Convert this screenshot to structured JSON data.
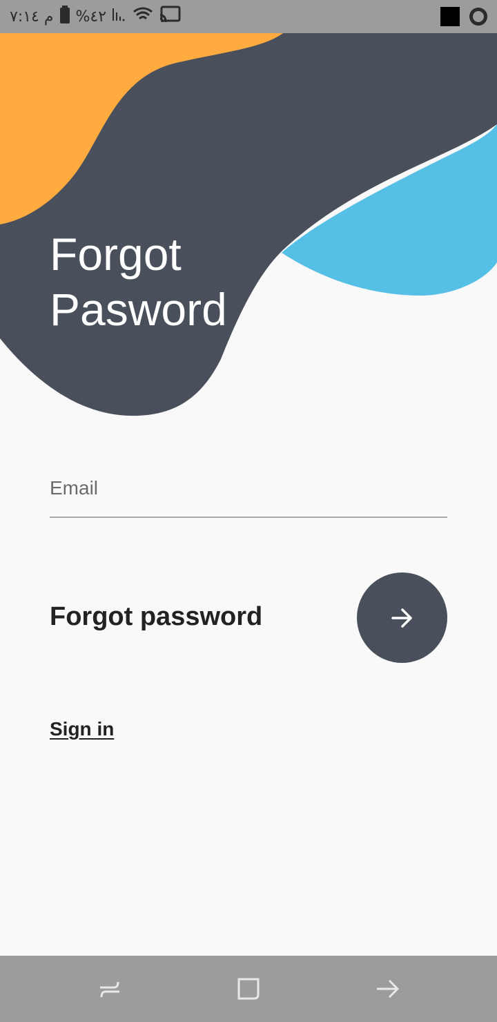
{
  "status_bar": {
    "time": "م ٧:١٤",
    "battery": "%٤٢",
    "icons": [
      "battery-icon",
      "signal-icon",
      "wifi-icon",
      "cast-icon",
      "square-notification-icon",
      "opera-icon"
    ]
  },
  "header": {
    "title_line1": "Forgot",
    "title_line2": "Pasword"
  },
  "form": {
    "email_placeholder": "Email",
    "email_value": "",
    "action_label": "Forgot password",
    "submit_icon": "arrow-right-icon",
    "sign_in_link": "Sign in"
  },
  "nav_bar": {
    "icons": [
      "recent-apps-icon",
      "home-icon",
      "back-icon"
    ]
  },
  "colors": {
    "dark": "#4a505b",
    "orange": "#ffab40",
    "blue": "#55bfe6",
    "background": "#f9f9f9"
  }
}
